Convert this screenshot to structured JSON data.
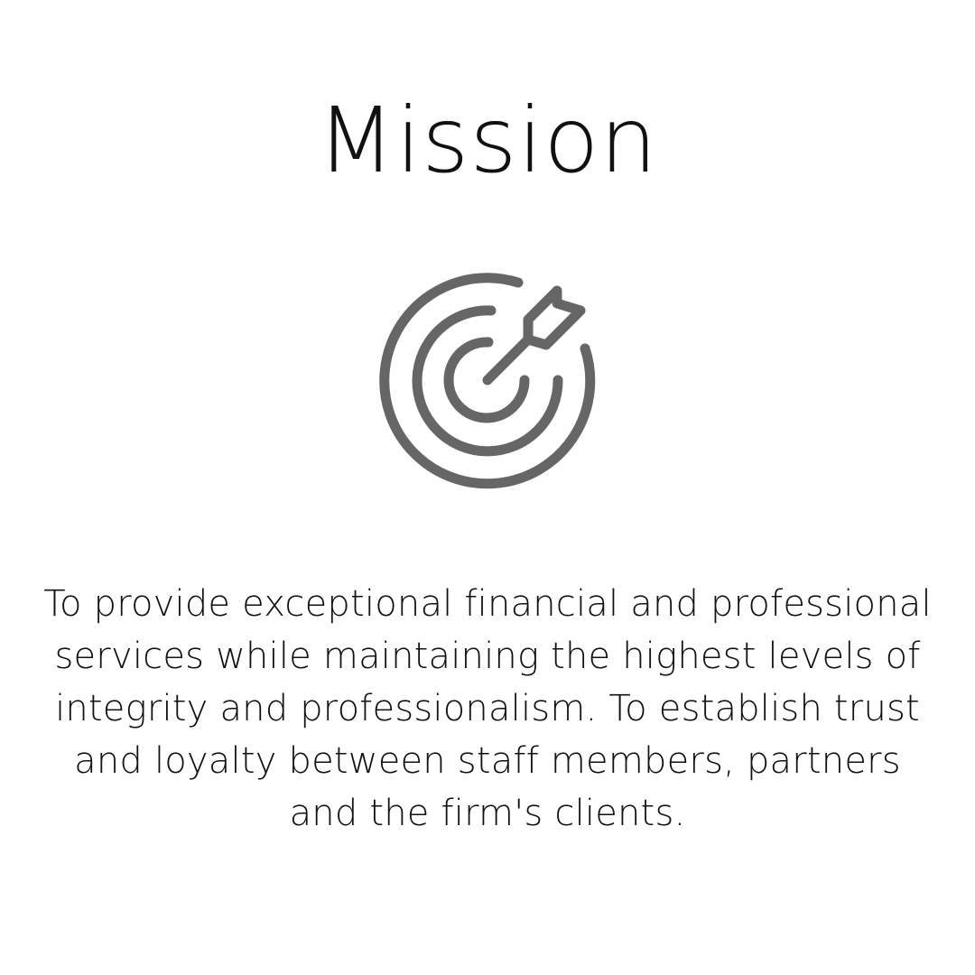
{
  "title": "Mission",
  "icon": {
    "name": "target-with-arrow",
    "color": "#666666"
  },
  "body": "To provide exceptional financial and professional services while maintaining the highest levels of integrity and professionalism. To establish trust and loyalty between staff members, partners and the firm's clients."
}
